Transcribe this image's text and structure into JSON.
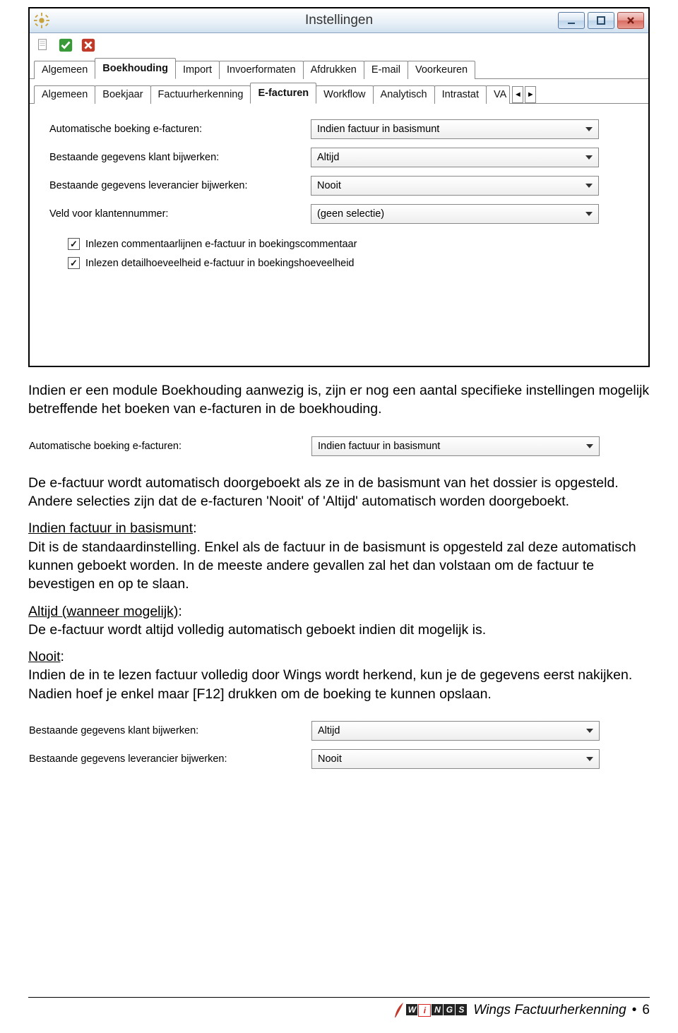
{
  "window": {
    "title": "Instellingen",
    "toolbar": {
      "icons": [
        "document-new",
        "checkbox-green",
        "checkbox-red"
      ]
    }
  },
  "tabs_main": [
    "Algemeen",
    "Boekhouding",
    "Import",
    "Invoerformaten",
    "Afdrukken",
    "E-mail",
    "Voorkeuren"
  ],
  "tabs_main_active": 1,
  "tabs_sub": [
    "Algemeen",
    "Boekjaar",
    "Factuurherkenning",
    "E-facturen",
    "Workflow",
    "Analytisch",
    "Intrastat",
    "VA"
  ],
  "tabs_sub_active": 3,
  "fields": {
    "auto_boeking": {
      "label": "Automatische boeking e-facturen:",
      "value": "Indien factuur in basismunt"
    },
    "klant_bijwerken": {
      "label": "Bestaande gegevens klant bijwerken:",
      "value": "Altijd"
    },
    "lever_bijwerken": {
      "label": "Bestaande gegevens leverancier bijwerken:",
      "value": "Nooit"
    },
    "veld_klantnr": {
      "label": "Veld voor klantennummer:",
      "value": "(geen selectie)"
    }
  },
  "checks": {
    "inlezen_commentaar": "Inlezen commentaarlijnen e-factuur in boekingscommentaar",
    "inlezen_detail": "Inlezen detailhoeveelheid e-factuur in boekingshoeveelheid"
  },
  "paragraphs": {
    "p1": "Indien er een module Boekhouding aanwezig is, zijn er nog een aantal specifieke instellingen mogelijk betreffende het boeken van e-facturen in de boekhouding.",
    "p2": "De e-factuur wordt automatisch doorgeboekt als ze in de basismunt van het dossier is opgesteld. Andere selecties zijn dat de e-facturen 'Nooit' of 'Altijd' automatisch worden doorgeboekt.",
    "p3a_u": "Indien factuur in basismunt",
    "p3b": "Dit is de standaardinstelling. Enkel als de factuur in de basismunt is opgesteld zal deze automatisch kunnen geboekt worden. In de meeste andere gevallen zal het dan volstaan om de factuur te bevestigen en op te slaan.",
    "p4a_u": "Altijd (wanneer mogelijk)",
    "p4b": "De e-factuur wordt altijd volledig automatisch geboekt indien dit mogelijk is.",
    "p5a_u": "Nooit",
    "p5b": "Indien de in te lezen factuur volledig door Wings wordt herkend, kun je de gegevens eerst nakijken. Nadien hoef je enkel maar [F12] drukken om de boeking te kunnen opslaan."
  },
  "footer": {
    "doc_title": "Wings Factuurherkenning",
    "page_number": "6",
    "bullet": "•"
  }
}
